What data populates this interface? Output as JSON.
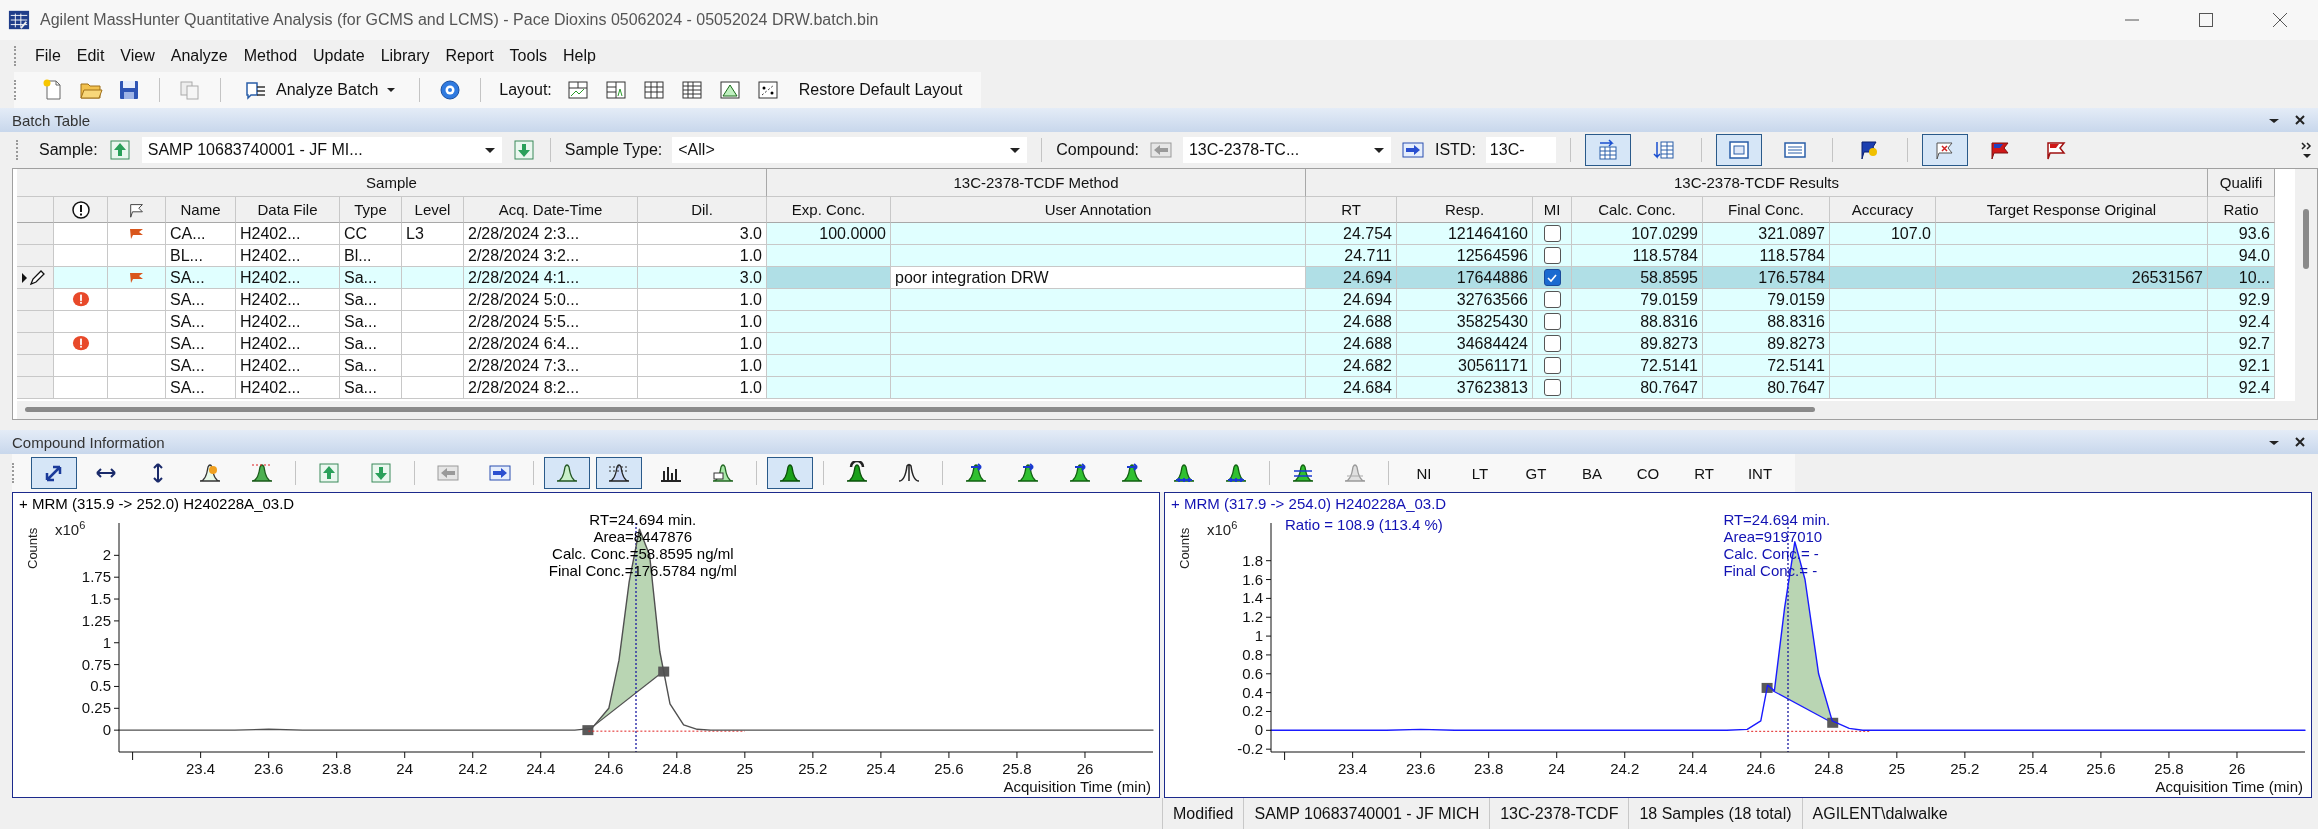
{
  "window": {
    "title": "Agilent MassHunter Quantitative Analysis (for GCMS and LCMS) - Pace Dioxins 05062024 - 05052024 DRW.batch.bin"
  },
  "menu": [
    "File",
    "Edit",
    "View",
    "Analyze",
    "Method",
    "Update",
    "Library",
    "Report",
    "Tools",
    "Help"
  ],
  "toolbar": {
    "analyze_label": "Analyze Batch",
    "layout_label": "Layout:",
    "restore_label": "Restore Default Layout"
  },
  "batch_table": {
    "title": "Batch Table",
    "sample": {
      "label": "Sample:",
      "value": "SAMP 10683740001 - JF MI..."
    },
    "sample_type": {
      "label": "Sample Type:",
      "value": "<All>"
    },
    "compound": {
      "label": "Compound:",
      "value": "13C-2378-TC..."
    },
    "istd": {
      "label": "ISTD:",
      "value": "13C-"
    },
    "view_buttons": [
      [
        {
          "kind": "table-right",
          "pressed": true
        },
        {
          "kind": "table-down",
          "pressed": false
        }
      ],
      [
        {
          "kind": "panel",
          "pressed": true
        },
        {
          "kind": "panel-wide",
          "pressed": false
        }
      ],
      [
        {
          "kind": "flag-blue",
          "pressed": false
        }
      ],
      [
        {
          "kind": "flag-outline",
          "pressed": true
        },
        {
          "kind": "flag-red",
          "pressed": false
        },
        {
          "kind": "flag-white",
          "pressed": false
        }
      ]
    ],
    "column_groups": [
      {
        "label": "Sample",
        "columns": [
          {
            "kind": "selector"
          },
          {
            "kind": "alert"
          },
          {
            "kind": "flag"
          },
          {
            "kind": "text",
            "label": "Name"
          },
          {
            "kind": "text",
            "label": "Data File"
          },
          {
            "kind": "text",
            "label": "Type"
          },
          {
            "kind": "text",
            "label": "Level"
          },
          {
            "kind": "text",
            "label": "Acq. Date-Time"
          },
          {
            "kind": "number",
            "label": "Dil."
          }
        ]
      },
      {
        "label": "13C-2378-TCDF Method",
        "columns": [
          {
            "kind": "number",
            "label": "Exp. Conc."
          },
          {
            "kind": "text",
            "label": "User Annotation",
            "editable": true
          }
        ]
      },
      {
        "label": "13C-2378-TCDF Results",
        "columns": [
          {
            "kind": "number",
            "label": "RT"
          },
          {
            "kind": "number",
            "label": "Resp."
          },
          {
            "kind": "check",
            "label": "MI"
          },
          {
            "kind": "number",
            "label": "Calc. Conc."
          },
          {
            "kind": "number",
            "label": "Final Conc."
          },
          {
            "kind": "number",
            "label": "Accuracy"
          },
          {
            "kind": "number",
            "label": "Target Response Original"
          }
        ]
      },
      {
        "label": "Qualifi",
        "columns": [
          {
            "kind": "number",
            "label": "Ratio"
          }
        ]
      }
    ],
    "rows": [
      {
        "selected": false,
        "alert": false,
        "flagged": true,
        "mi_checked": false,
        "cells": [
          "CA...",
          "H2402...",
          "CC",
          "L3",
          "2/28/2024 2:3...",
          "3.0",
          "100.0000",
          null,
          "24.754",
          "121464160",
          "107.0299",
          "321.0897",
          "107.0",
          null,
          "93.6"
        ]
      },
      {
        "selected": false,
        "alert": false,
        "flagged": false,
        "mi_checked": false,
        "cells": [
          "BL...",
          "H2402...",
          "Bl...",
          null,
          "2/28/2024 3:2...",
          "1.0",
          null,
          null,
          "24.711",
          "12564596",
          "118.5784",
          "118.5784",
          null,
          null,
          "94.0"
        ]
      },
      {
        "selected": true,
        "alert": false,
        "flagged": true,
        "mi_checked": true,
        "cells": [
          "SA...",
          "H2402...",
          "Sa...",
          null,
          "2/28/2024 4:1...",
          "3.0",
          null,
          "poor integration DRW",
          "24.694",
          "17644886",
          "58.8595",
          "176.5784",
          null,
          "26531567",
          "10..."
        ]
      },
      {
        "selected": false,
        "alert": true,
        "flagged": false,
        "mi_checked": false,
        "cells": [
          "SA...",
          "H2402...",
          "Sa...",
          null,
          "2/28/2024 5:0...",
          "1.0",
          null,
          null,
          "24.694",
          "32763566",
          "79.0159",
          "79.0159",
          null,
          null,
          "92.9"
        ]
      },
      {
        "selected": false,
        "alert": false,
        "flagged": false,
        "mi_checked": false,
        "cells": [
          "SA...",
          "H2402...",
          "Sa...",
          null,
          "2/28/2024 5:5...",
          "1.0",
          null,
          null,
          "24.688",
          "35825430",
          "88.8316",
          "88.8316",
          null,
          null,
          "92.4"
        ]
      },
      {
        "selected": false,
        "alert": true,
        "flagged": false,
        "mi_checked": false,
        "cells": [
          "SA...",
          "H2402...",
          "Sa...",
          null,
          "2/28/2024 6:4...",
          "1.0",
          null,
          null,
          "24.688",
          "34684424",
          "89.8273",
          "89.8273",
          null,
          null,
          "92.7"
        ]
      },
      {
        "selected": false,
        "alert": false,
        "flagged": false,
        "mi_checked": false,
        "cells": [
          "SA...",
          "H2402...",
          "Sa...",
          null,
          "2/28/2024 7:3...",
          "1.0",
          null,
          null,
          "24.682",
          "30561171",
          "72.5141",
          "72.5141",
          null,
          null,
          "92.1"
        ]
      },
      {
        "selected": false,
        "alert": false,
        "flagged": false,
        "mi_checked": false,
        "cells": [
          "SA...",
          "H2402...",
          "Sa...",
          null,
          "2/28/2024 8:2...",
          "1.0",
          null,
          null,
          "24.684",
          "37623813",
          "80.7647",
          "80.7647",
          null,
          null,
          "92.4"
        ]
      }
    ]
  },
  "compound_info": {
    "title": "Compound Information",
    "toolbar": [
      [
        {
          "kind": "zoom",
          "pressed": true
        },
        {
          "kind": "arrows-h",
          "pressed": false
        },
        {
          "kind": "arrows-v",
          "pressed": false
        },
        {
          "kind": "peak-pick",
          "pressed": false
        },
        {
          "kind": "peak-baseline",
          "pressed": false
        }
      ],
      [
        {
          "kind": "up",
          "pressed": false
        },
        {
          "kind": "down",
          "pressed": false
        }
      ],
      [
        {
          "kind": "left",
          "pressed": false
        },
        {
          "kind": "right",
          "pressed": false
        }
      ],
      [
        {
          "kind": "peak-outline",
          "pressed": true
        },
        {
          "kind": "peak-dashed",
          "pressed": true
        },
        {
          "kind": "bars",
          "pressed": false
        },
        {
          "kind": "peak-is",
          "pressed": false
        }
      ],
      [
        {
          "kind": "peak-green",
          "pressed": true
        }
      ],
      [
        {
          "kind": "peak-split",
          "pressed": false
        },
        {
          "kind": "peak-line",
          "pressed": false
        }
      ],
      [
        {
          "kind": "peak-arrow",
          "pressed": false
        },
        {
          "kind": "peak-arrow",
          "pressed": false
        },
        {
          "kind": "peak-arrow",
          "pressed": false
        },
        {
          "kind": "peak-arrow",
          "pressed": false
        },
        {
          "kind": "peak-triple",
          "pressed": false
        },
        {
          "kind": "peak-triple",
          "pressed": false
        }
      ],
      [
        {
          "kind": "peak-stack",
          "pressed": false
        },
        {
          "kind": "peak-grey",
          "pressed": false
        }
      ],
      [
        {
          "kind": "text",
          "label": "NI",
          "pressed": false
        },
        {
          "kind": "text",
          "label": "LT",
          "pressed": false
        },
        {
          "kind": "text",
          "label": "GT",
          "pressed": false
        },
        {
          "kind": "text",
          "label": "BA",
          "pressed": false
        },
        {
          "kind": "text",
          "label": "CO",
          "pressed": false
        },
        {
          "kind": "text",
          "label": "RT",
          "pressed": false
        },
        {
          "kind": "text",
          "label": "INT",
          "pressed": false
        }
      ]
    ],
    "charts": [
      {
        "title": "+ MRM (315.9 -> 252.0) H240228A_03.D",
        "multiplier": {
          "base": "x10",
          "exponent": "6"
        },
        "chart_data": {
          "type": "line",
          "xlabel": "Acquisition Time (min)",
          "ylabel": "Counts",
          "x": [
            23.16,
            23.5,
            23.6,
            23.7,
            24.5,
            24.55,
            24.6,
            24.63,
            24.66,
            24.69,
            24.72,
            24.75,
            24.78,
            24.82,
            24.86,
            24.9,
            26.2
          ],
          "series": [
            {
              "color": "#505050",
              "values": [
                0,
                0,
                0.01,
                0,
                0,
                0.02,
                0.25,
                0.8,
                1.7,
                2.3,
                2.0,
                0.9,
                0.3,
                0.06,
                0.01,
                0,
                0
              ]
            }
          ],
          "xlim": [
            23.16,
            26.2
          ],
          "ylim": [
            -0.25,
            2.37
          ],
          "xticks": [
            23.4,
            23.6,
            23.8,
            24,
            24.2,
            24.4,
            24.6,
            24.8,
            25,
            25.2,
            25.4,
            25.6,
            25.8,
            26
          ],
          "yticks": [
            0,
            0.25,
            0.5,
            0.75,
            1,
            1.25,
            1.5,
            1.75,
            2
          ],
          "ref_lines": [
            {
              "axis": "x",
              "value": 24.68
            },
            {
              "axis": "y",
              "value": 0
            }
          ]
        },
        "peak_label": [
          "RT=24.694 min.",
          "Area=8447876",
          "Calc. Conc.=58.8595 ng/ml",
          "Final Conc.=176.5784 ng/ml"
        ]
      },
      {
        "title": "+ MRM (317.9 -> 254.0) H240228A_03.D",
        "multiplier": {
          "base": "x10",
          "exponent": "6"
        },
        "chart_data": {
          "type": "line",
          "xlabel": "Acquisition Time (min)",
          "ylabel": "Counts",
          "x": [
            23.16,
            23.5,
            23.6,
            23.7,
            24.5,
            24.56,
            24.6,
            24.62,
            24.64,
            24.67,
            24.7,
            24.73,
            24.77,
            24.81,
            24.86,
            24.9,
            26.2
          ],
          "series": [
            {
              "color": "#1a1aff",
              "values": [
                0,
                0,
                0.01,
                0,
                0,
                0.01,
                0.1,
                0.48,
                0.42,
                1.3,
                2.0,
                1.6,
                0.6,
                0.1,
                0.02,
                0,
                0
              ]
            }
          ],
          "xlim": [
            23.16,
            26.2
          ],
          "ylim": [
            -0.23,
            2.2
          ],
          "xticks": [
            23.4,
            23.6,
            23.8,
            24,
            24.2,
            24.4,
            24.6,
            24.8,
            25,
            25.2,
            25.4,
            25.6,
            25.8,
            26
          ],
          "yticks": [
            -0.2,
            0,
            0.2,
            0.4,
            0.6,
            0.8,
            1,
            1.2,
            1.4,
            1.6,
            1.8
          ],
          "ref_lines": [
            {
              "axis": "x",
              "value": 24.68
            },
            {
              "axis": "y",
              "value": 0
            }
          ]
        },
        "peak_label": [
          "RT=24.694 min.",
          "Area=9197010",
          "Calc. Conc.= -",
          "Final Conc.= -"
        ],
        "note": "Ratio = 108.9 (113.4 %)"
      }
    ]
  },
  "status_bar": [
    "Modified",
    "SAMP 10683740001 - JF MICH",
    "13C-2378-TCDF",
    "18 Samples (18 total)",
    "AGILENT\\dalwalke"
  ]
}
